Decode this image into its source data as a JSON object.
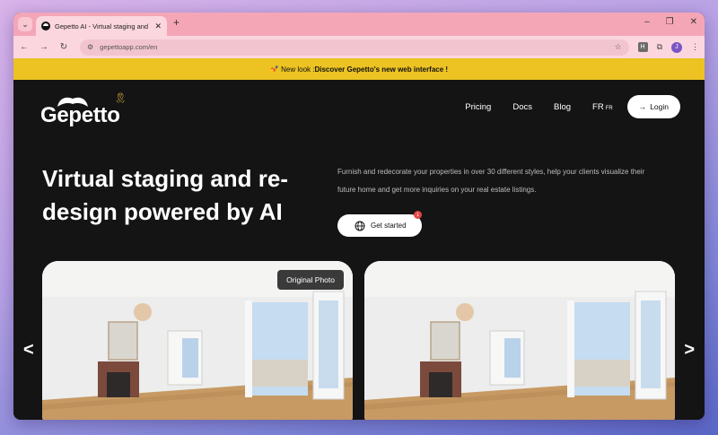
{
  "browser": {
    "tab_title": "Gepetto AI - Virtual staging and",
    "new_tab": "+",
    "url": "gepettoapp.com/en",
    "controls": {
      "minimize": "–",
      "restore": "❐",
      "close": "✕"
    },
    "profile_initial": "J",
    "extension_label": "H"
  },
  "banner": {
    "emoji": "💅",
    "prefix": "New look : ",
    "bold": "Discover Gepetto's new web interface !"
  },
  "header": {
    "logo_text": "Gepetto",
    "nav": {
      "pricing": "Pricing",
      "docs": "Docs",
      "blog": "Blog",
      "lang": "FR",
      "lang_small": "FR",
      "login": "Login"
    }
  },
  "hero": {
    "title": "Virtual staging and re-design powered by AI",
    "description": "Furnish and redecorate your properties in over 30 different styles, help your clients visualize their future home and get more inquiries on your real estate listings.",
    "cta": "Get started",
    "cta_badge": "1"
  },
  "gallery": {
    "original_label": "Original Photo"
  },
  "icons": {
    "tab_menu": "chevron-down-icon",
    "back": "back-arrow-icon",
    "forward": "forward-arrow-icon",
    "reload": "reload-icon",
    "site_info": "site-info-icon",
    "bookmark": "star-icon",
    "extensions": "puzzle-icon",
    "menu": "more-vertical-icon",
    "globe": "globe-icon",
    "prev": "chevron-left-icon",
    "next": "chevron-right-icon"
  },
  "colors": {
    "banner": "#ecc322",
    "page_bg": "#141414",
    "tabstrip": "#f4a6b7"
  }
}
